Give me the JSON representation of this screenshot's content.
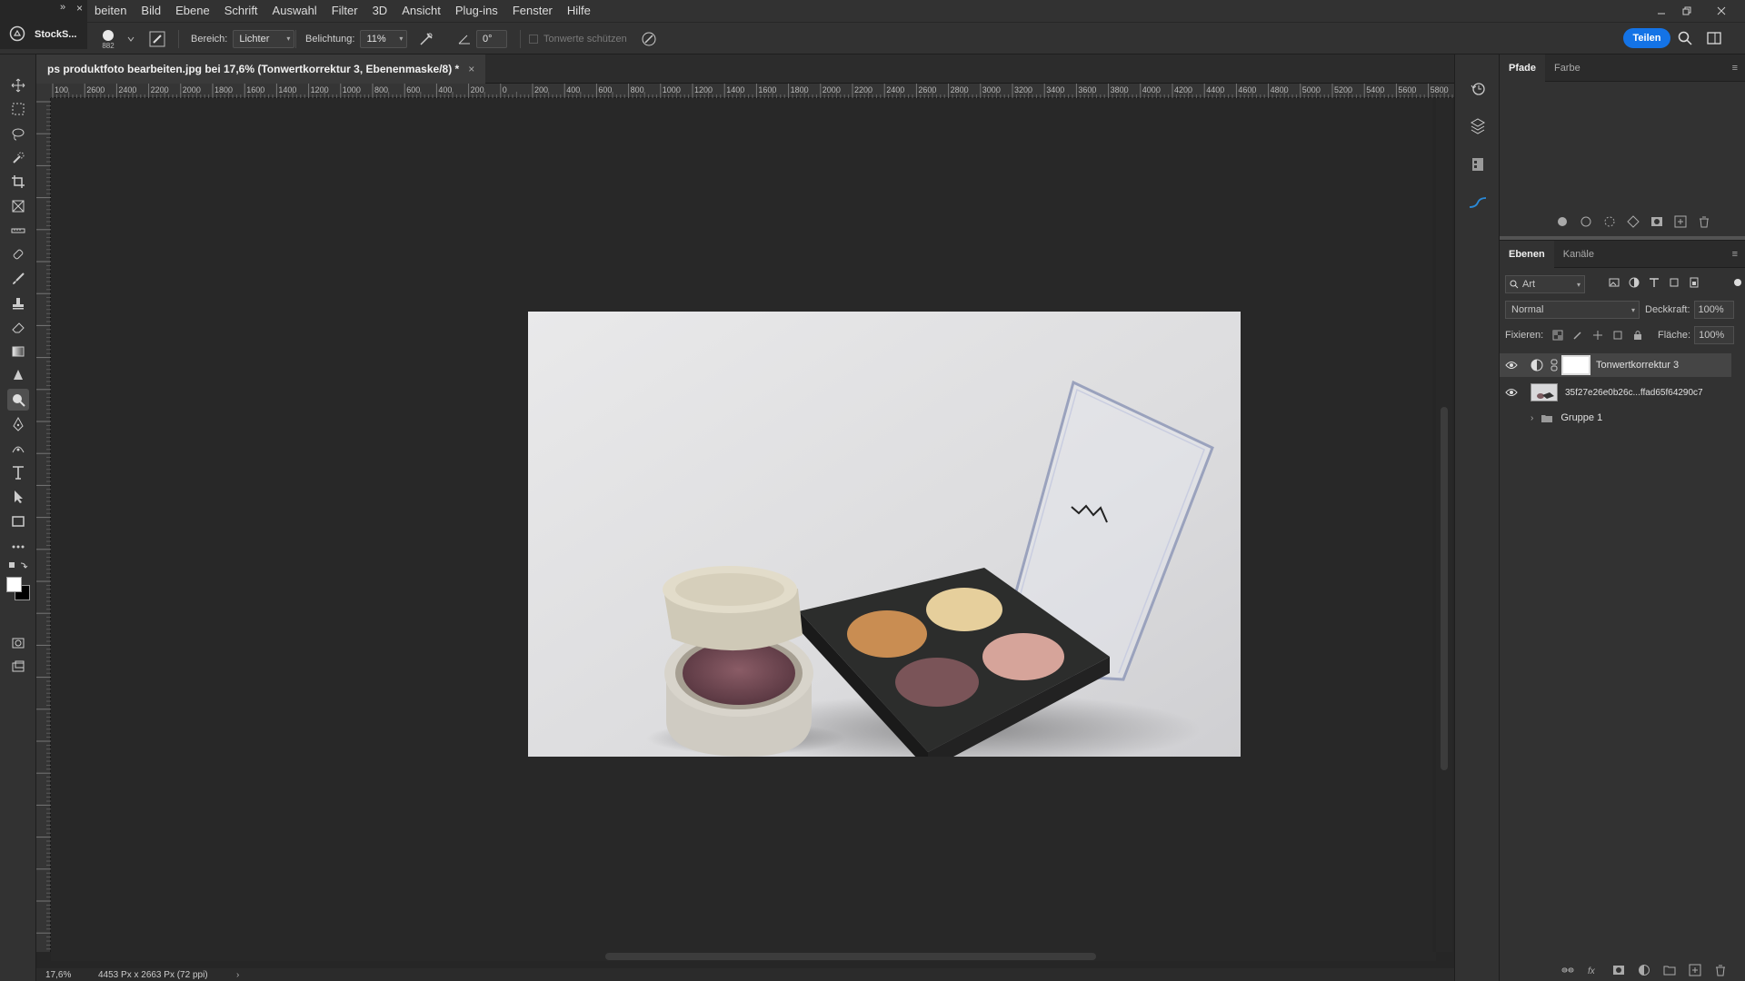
{
  "app": {
    "workspace": "StockS...",
    "more": "»",
    "close": "×"
  },
  "menu": [
    "beiten",
    "Bild",
    "Ebene",
    "Schrift",
    "Auswahl",
    "Filter",
    "3D",
    "Ansicht",
    "Plug-ins",
    "Fenster",
    "Hilfe"
  ],
  "options": {
    "brush_size": "882",
    "range_label": "Bereich:",
    "range_value": "Lichter",
    "exposure_label": "Belichtung:",
    "exposure_value": "11%",
    "angle_value": "0°",
    "protect_tones": "Tonwerte schützen"
  },
  "share_label": "Teilen",
  "document": {
    "tab_title": "ps produktfoto bearbeiten.jpg bei 17,6% (Tonwertkorrektur 3, Ebenenmaske/8) *",
    "close": "×"
  },
  "ruler_labels": [
    "100",
    "2600",
    "2400",
    "2200",
    "2000",
    "1800",
    "1600",
    "1400",
    "1200",
    "1000",
    "800",
    "600",
    "400",
    "200",
    "0",
    "200",
    "400",
    "600",
    "800",
    "1000",
    "1200",
    "1400",
    "1600",
    "1800",
    "2000",
    "2200",
    "2400",
    "2600",
    "2800",
    "3000",
    "3200",
    "3400",
    "3600",
    "3800",
    "4000",
    "4200",
    "4400",
    "4600",
    "4800",
    "5000",
    "5200",
    "5400",
    "5600",
    "5800"
  ],
  "status": {
    "zoom": "17,6%",
    "doc_info": "4453 Px x 2663 Px (72 ppi)"
  },
  "paths_panel": {
    "tabs": [
      "Pfade",
      "Farbe"
    ]
  },
  "layers_panel": {
    "tabs": [
      "Ebenen",
      "Kanäle"
    ],
    "filter_value": "Art",
    "blend_mode": "Normal",
    "opacity_label": "Deckkraft:",
    "opacity_value": "100%",
    "lock_label": "Fixieren:",
    "fill_label": "Fläche:",
    "fill_value": "100%",
    "layers": [
      {
        "name": "Tonwertkorrektur 3",
        "visible": true,
        "selected": true
      },
      {
        "name": "35f27e26e0b26c...ffad65f64290c7",
        "visible": true,
        "selected": false
      },
      {
        "name": "Gruppe 1",
        "visible": false,
        "selected": false
      }
    ]
  },
  "colors": {
    "accent": "#1473e6",
    "fg": "#ffffff",
    "bg": "#000000"
  }
}
